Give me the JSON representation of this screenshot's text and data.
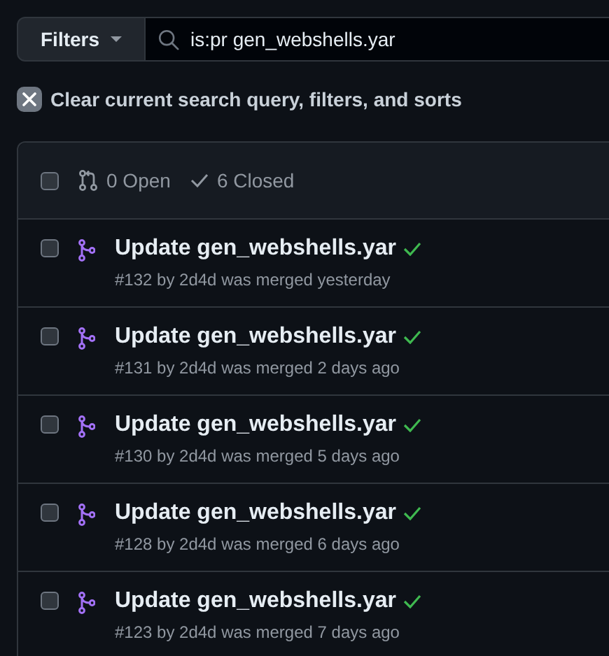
{
  "filters_button": {
    "label": "Filters"
  },
  "search": {
    "value": "is:pr gen_webshells.yar"
  },
  "clear_link": {
    "label": "Clear current search query, filters, and sorts"
  },
  "list_header": {
    "select_all_checked": false,
    "open_count": "0 Open",
    "closed_count": "6 Closed"
  },
  "pull_requests": [
    {
      "title": "Update gen_webshells.yar",
      "meta": "#132 by 2d4d was merged yesterday",
      "merged": true,
      "checks_passed": true,
      "checked": false
    },
    {
      "title": "Update gen_webshells.yar",
      "meta": "#131 by 2d4d was merged 2 days ago",
      "merged": true,
      "checks_passed": true,
      "checked": false
    },
    {
      "title": "Update gen_webshells.yar",
      "meta": "#130 by 2d4d was merged 5 days ago",
      "merged": true,
      "checks_passed": true,
      "checked": false
    },
    {
      "title": "Update gen_webshells.yar",
      "meta": "#128 by 2d4d was merged 6 days ago",
      "merged": true,
      "checks_passed": true,
      "checked": false
    },
    {
      "title": "Update gen_webshells.yar",
      "meta": "#123 by 2d4d was merged 7 days ago",
      "merged": true,
      "checks_passed": true,
      "checked": false
    }
  ]
}
